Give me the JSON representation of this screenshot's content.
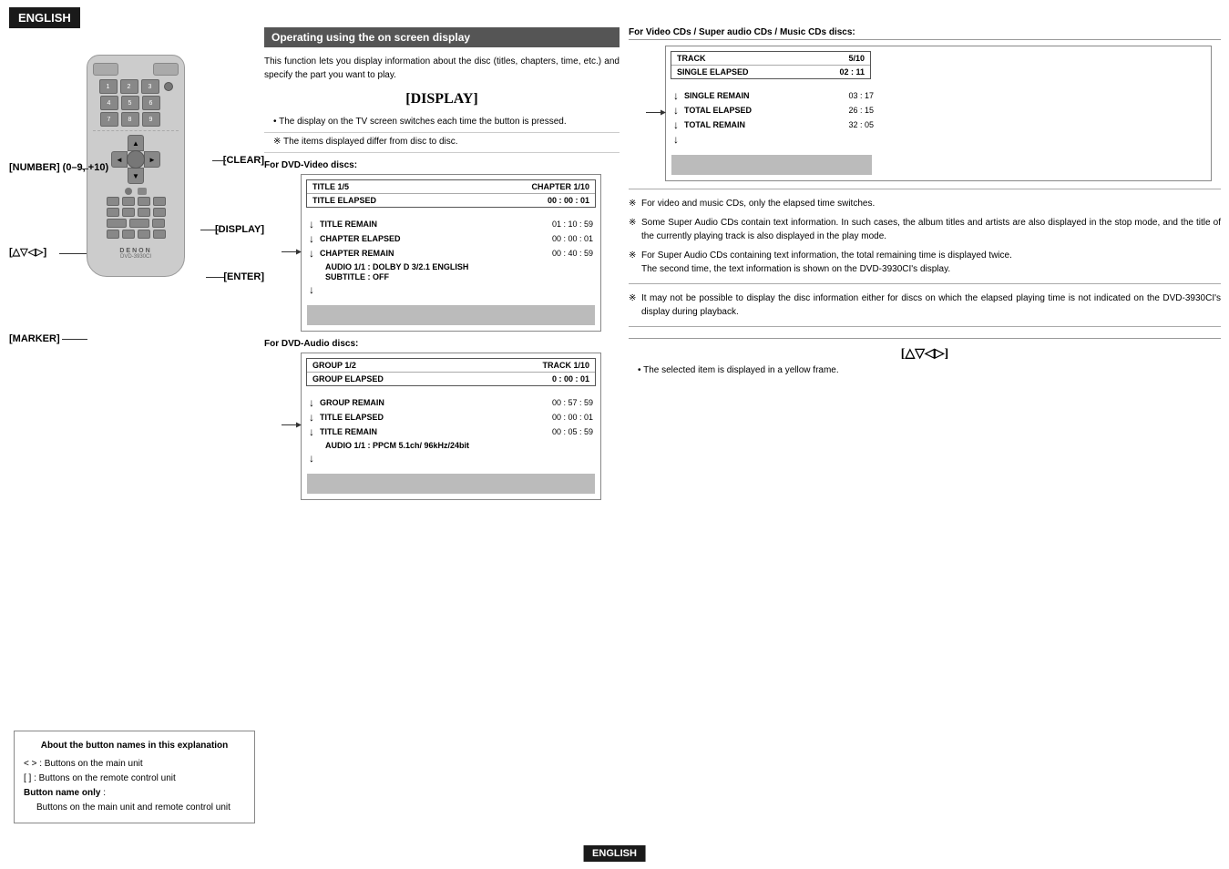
{
  "header": {
    "language": "ENGLISH"
  },
  "footer": {
    "label": "ENGLISH"
  },
  "remote_labels": {
    "number": "[NUMBER] (0–9, +10)",
    "clear": "[CLEAR]",
    "display": "[DISPLAY]",
    "nav": "[△▽◁▷]",
    "enter": "[ENTER]",
    "marker": "[MARKER]"
  },
  "info_box": {
    "title": "About the button names in this explanation",
    "line1_sym": "< >",
    "line1_text": ": Buttons on the main unit",
    "line2_sym": "[   ]",
    "line2_text": ": Buttons on the remote control unit",
    "bold_label": "Button name only",
    "bold_suffix": " :",
    "last_line": "Buttons on the main unit and remote control unit"
  },
  "middle": {
    "section_title": "Operating using the on screen display",
    "intro": "This function lets you display information about the disc (titles, chapters, time, etc.) and specify the part you want to play.",
    "display_heading": "[DISPLAY]",
    "bullet1": "• The display on the TV screen switches each time the button is pressed.",
    "note1": "※ The items displayed differ from disc to disc.",
    "dvd_video_title": "For DVD-Video discs:",
    "dvd_video_diagram": {
      "row1_left": "TITLE 1/5",
      "row1_right": "CHAPTER 1/10",
      "row2_left": "TITLE ELAPSED",
      "row2_right": "00 : 00 : 01",
      "items": [
        {
          "label": "TITLE REMAIN",
          "value": "01 : 10 : 59"
        },
        {
          "label": "CHAPTER ELAPSED",
          "value": "00 : 00 : 01"
        },
        {
          "label": "CHAPTER REMAIN",
          "value": "00 : 40 : 59"
        }
      ],
      "audio_line": "AUDIO  1/1 : DOLBY D 3/2.1  ENGLISH",
      "subtitle_line": "SUBTITLE : OFF"
    },
    "dvd_audio_title": "For DVD-Audio discs:",
    "dvd_audio_diagram": {
      "row1_left": "GROUP 1/2",
      "row1_right": "TRACK 1/10",
      "row2_left": "GROUP ELAPSED",
      "row2_right": "0 : 00 : 01",
      "items": [
        {
          "label": "GROUP REMAIN",
          "value": "00 : 57 : 59"
        },
        {
          "label": "TITLE ELAPSED",
          "value": "00 : 00 : 01"
        },
        {
          "label": "TITLE REMAIN",
          "value": "00 : 05 : 59"
        }
      ],
      "audio_line": "AUDIO  1/1 : PPCM 5.1ch/  96kHz/24bit"
    }
  },
  "right": {
    "vcd_title": "For Video CDs / Super audio CDs / Music CDs discs:",
    "vcd_diagram": {
      "row1_left": "TRACK",
      "row1_right": "5/10",
      "row2_left": "SINGLE ELAPSED",
      "row2_right": "02 : 11",
      "items": [
        {
          "label": "SINGLE REMAIN",
          "value": "03 : 17"
        },
        {
          "label": "TOTAL ELAPSED",
          "value": "26 : 15"
        },
        {
          "label": "TOTAL REMAIN",
          "value": "32 : 05"
        }
      ]
    },
    "notes": [
      "For video and music CDs, only the elapsed time switches.",
      "Some Super Audio CDs contain text information. In such cases, the album titles and artists are also displayed in the stop mode, and the title of the currently playing track is also displayed in the play mode.",
      "For Super Audio CDs containing text information, the total remaining time is displayed twice.\nThe second time, the text information is shown on the DVD-3930CI's display.",
      "It may not be possible to display the disc information either for discs on which the elapsed playing time is not indicated on the DVD-3930CI's display during playback."
    ],
    "nav_heading": "[△▽◁▷]",
    "nav_bullet": "• The selected item is displayed in a yellow frame."
  }
}
